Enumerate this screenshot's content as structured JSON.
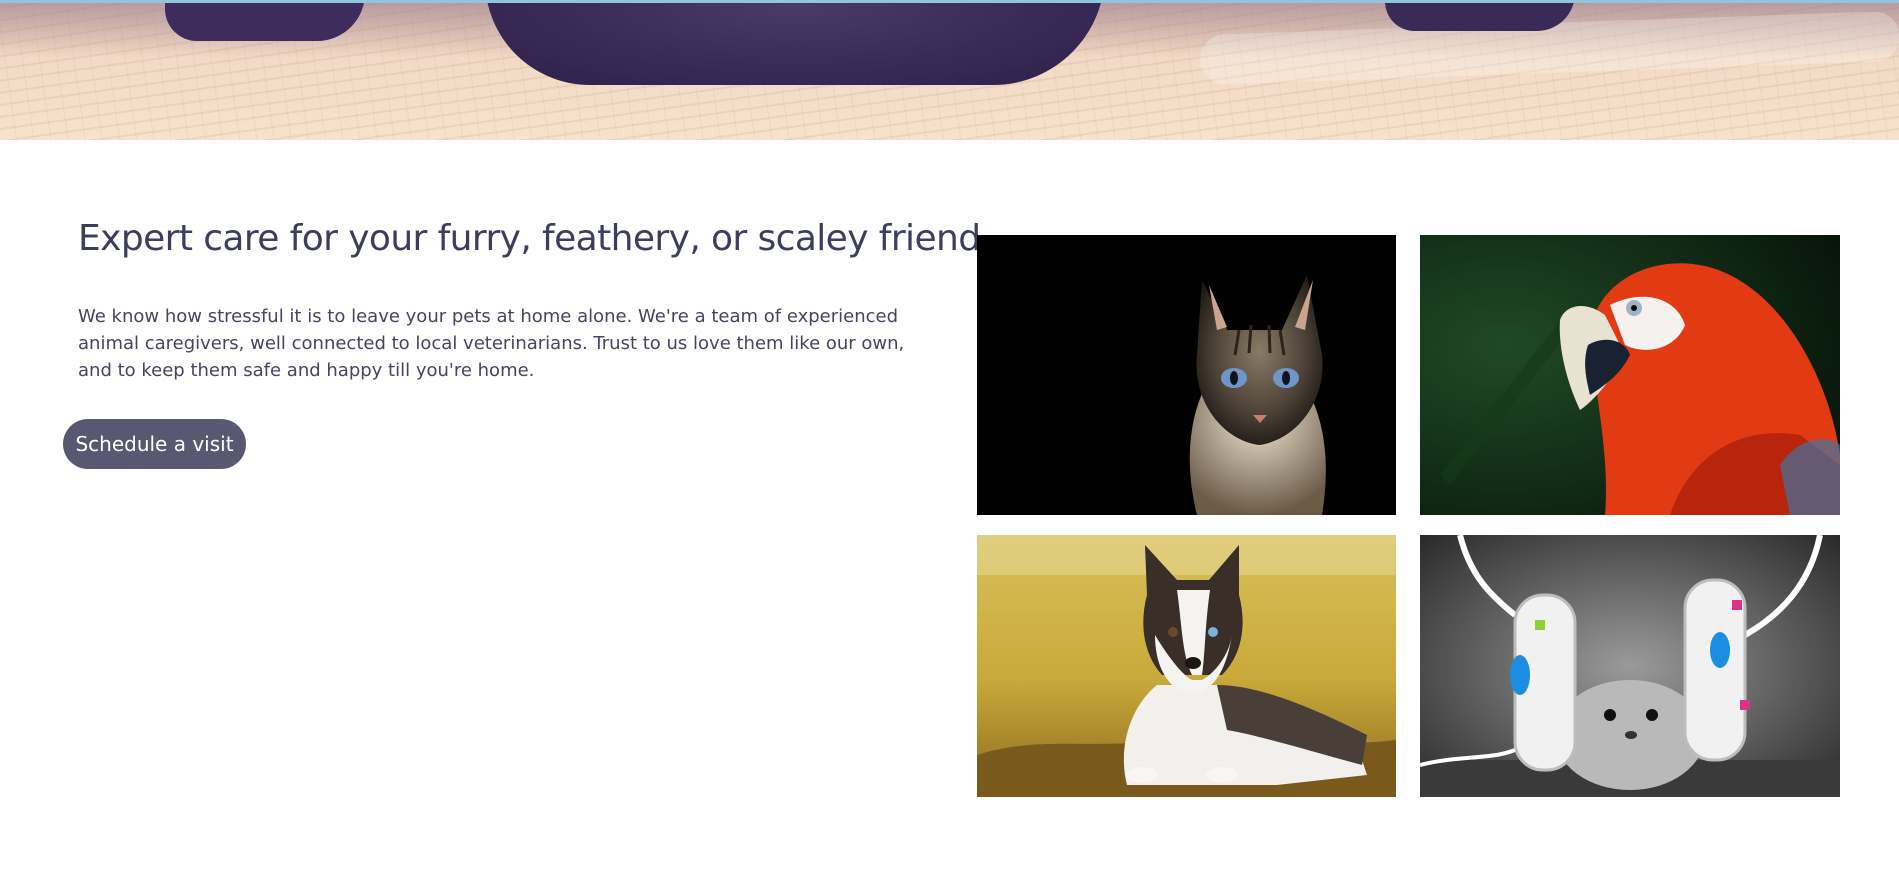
{
  "hero": {
    "image": "sleeping-pet-paws-on-blanket"
  },
  "intro": {
    "headline": "Expert care for your furry, feathery, or scaley friend",
    "body": "We know how stressful it is to leave your pets at home alone. We're a team of experienced animal caregivers, well connected to local veterinarians. Trust to us love them like our own, and to keep them safe and happy till you're home.",
    "cta_label": "Schedule a visit"
  },
  "gallery": {
    "photos": [
      {
        "subject": "cat"
      },
      {
        "subject": "parrot"
      },
      {
        "subject": "husky"
      },
      {
        "subject": "hamster"
      }
    ]
  },
  "colors": {
    "heading": "#3d3d5c",
    "text": "#454560",
    "cta_background": "#585873",
    "cta_text": "#ffffff",
    "hero_tone": "#3a2a58"
  }
}
